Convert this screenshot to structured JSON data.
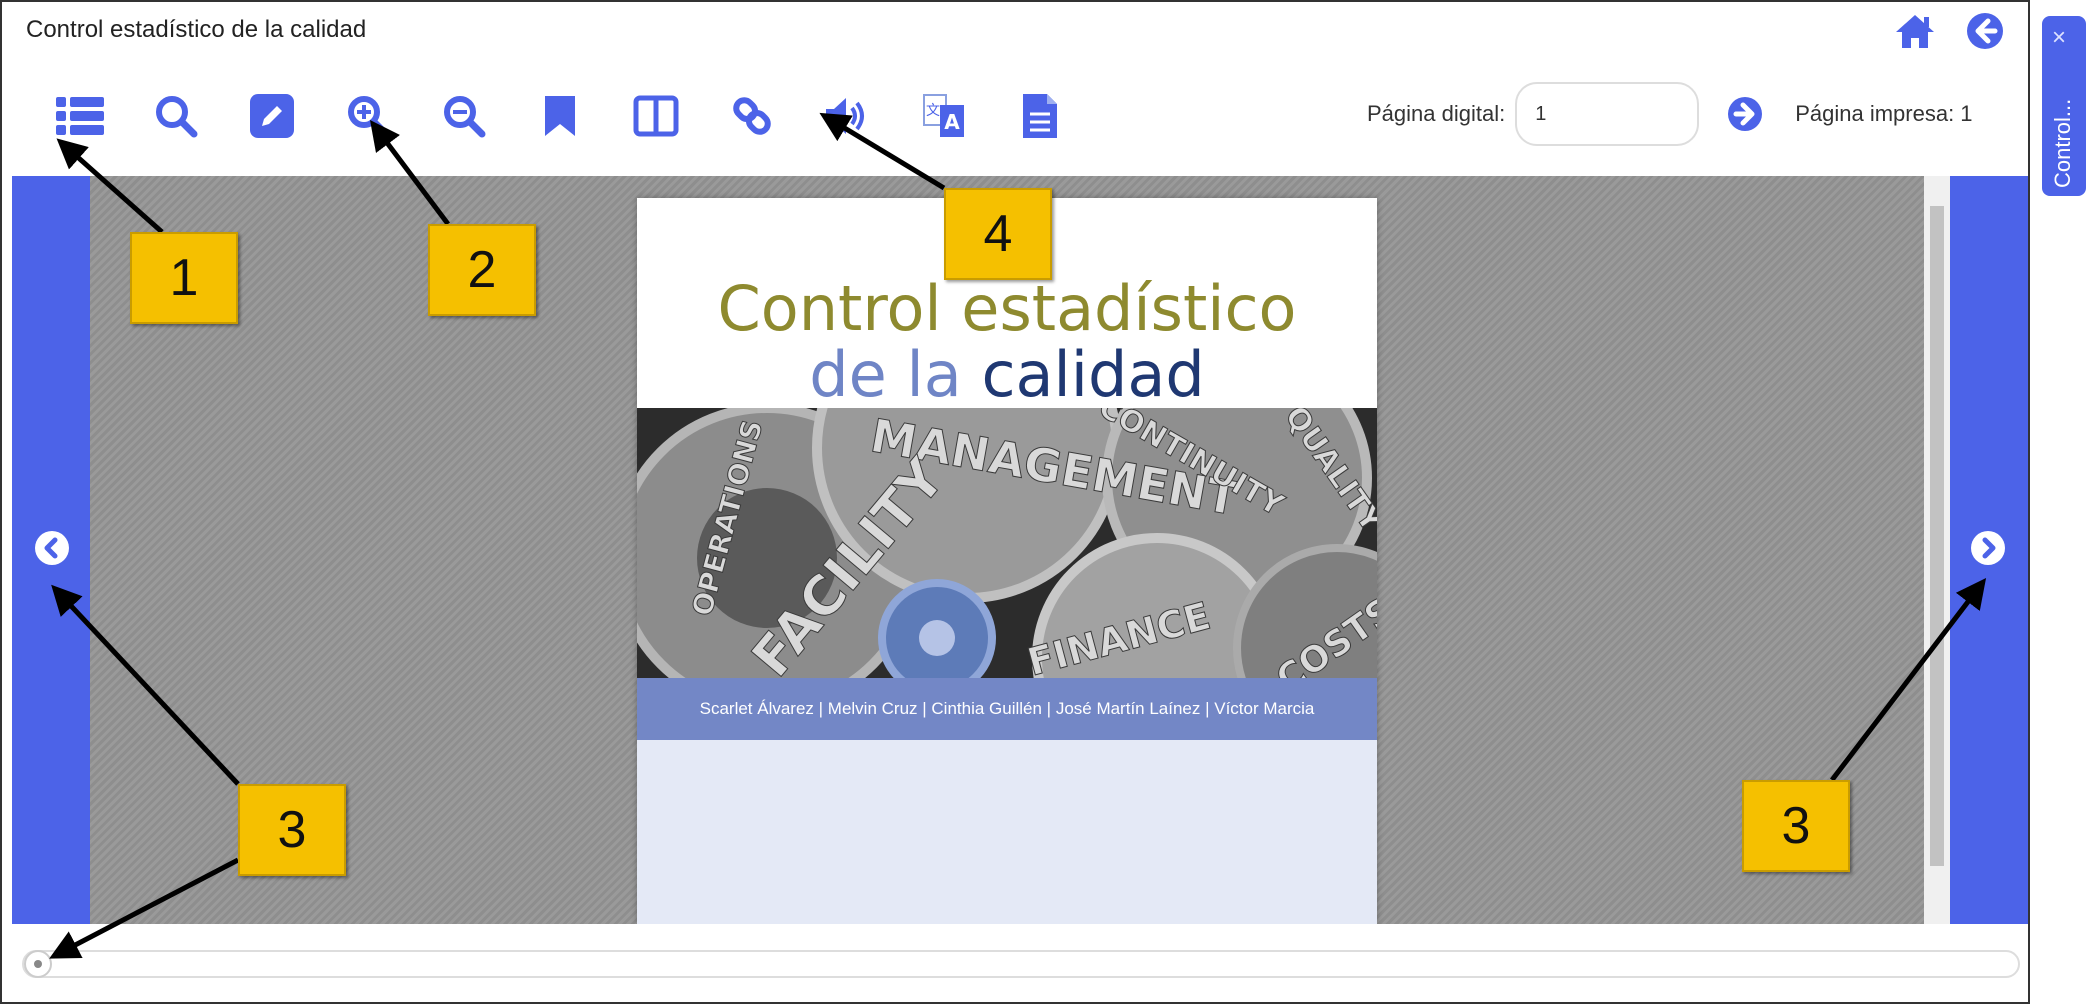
{
  "app": {
    "title": "Control estadístico de la calidad"
  },
  "header": {
    "page_digital_label": "Página digital:",
    "page_digital_value": "1",
    "page_printed_label": "Página impresa: 1"
  },
  "book": {
    "title_line1": "Control estadístico",
    "title_line2_a": "de la",
    "title_line2_b": "calidad",
    "gear_words": [
      "MANAGEMENT",
      "CONTINUITY",
      "QUALITY",
      "OPERATIONS",
      "FACILITY",
      "FINANCE",
      "COSTS"
    ],
    "authors": "Scarlet Álvarez | Melvin Cruz | Cinthia Guillén | José Martín Laínez | Víctor Marcia"
  },
  "side_tab": {
    "close": "×",
    "label": "Control..."
  },
  "callouts": [
    "1",
    "2",
    "3",
    "3",
    "4"
  ],
  "colors": {
    "accent": "#4c63e8",
    "callout": "#f5c000",
    "title_olive": "#8e8a2f",
    "title_navy": "#1f3872"
  },
  "icons": [
    "list-icon",
    "search-icon",
    "edit-icon",
    "zoom-in-icon",
    "zoom-out-icon",
    "bookmark-icon",
    "columns-icon",
    "link-icon",
    "audio-icon",
    "translate-icon",
    "document-icon",
    "home-icon",
    "back-icon",
    "go-icon",
    "prev-page-icon",
    "next-page-icon"
  ]
}
